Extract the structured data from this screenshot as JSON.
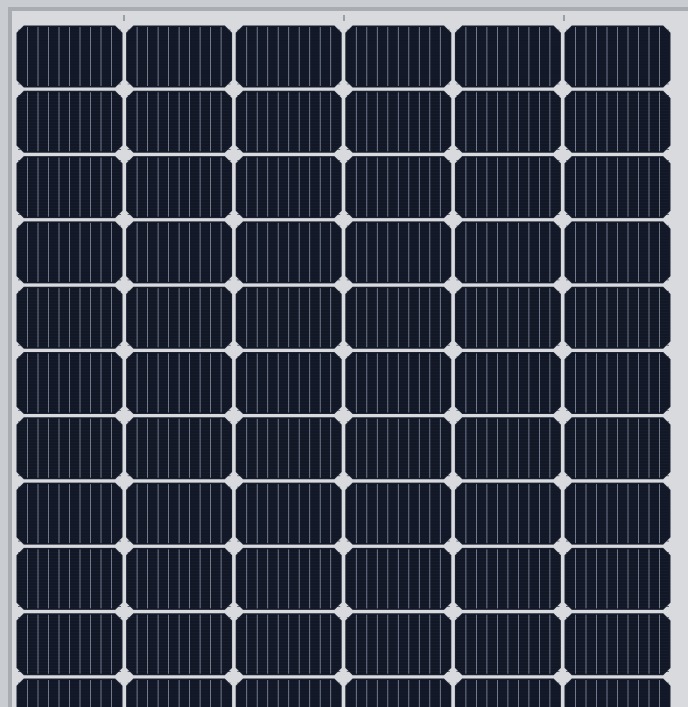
{
  "panel": {
    "columns": 6,
    "visible_rows": 11,
    "busbars_per_cell": 9,
    "cell_type": "monocrystalline, chamfered corners",
    "colors": {
      "frame_outer": "#c9ccd0",
      "frame_inner": "#a9adb2",
      "backsheet": "#d8dadd",
      "cell": "#111725",
      "cell_edge": "#1b2233",
      "finger": "#1a2030",
      "busbar": "#8a93a6"
    }
  }
}
